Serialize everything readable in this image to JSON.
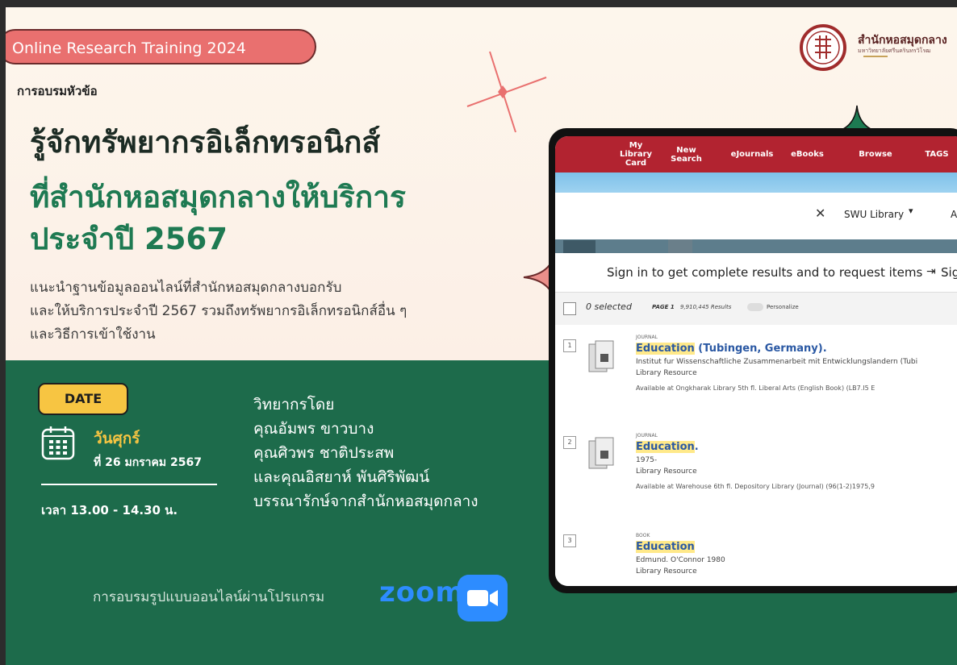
{
  "banner": "Online Research Training 2024",
  "subtitle_small": "การอบรมหัวข้อ",
  "title_line1": "รู้จักทรัพยากรอิเล็กทรอนิกส์",
  "title_line2": "ที่สำนักหอสมุดกลางให้บริการ",
  "title_line3": "ประจำปี 2567",
  "desc_line1": "แนะนำฐานข้อมูลออนไลน์ที่สำนักหอสมุดกลางบอกรับ",
  "desc_line2": "และให้บริการประจำปี 2567 รวมถึงทรัพยากรอิเล็กทรอนิกส์อื่น ๆ",
  "desc_line3": "และวิธีการเข้าใช้งาน",
  "date_badge": "DATE",
  "day": "วันศุกร์",
  "date": "ที่ 26 มกราคม 2567",
  "time": "เวลา 13.00 - 14.30 น.",
  "speakers": [
    "วิทยากรโดย",
    "คุณอัมพร ขาวบาง",
    "คุณศิวพร ชาติประสพ",
    "และคุณอิสยาห์ พันศิริพัฒน์",
    "บรรณารักษ์จากสำนักหอสมุดกลาง"
  ],
  "zoom_text": "การอบรมรูปแบบออนไลน์ผ่านโปรแกรม",
  "zoom_logo": "zoom",
  "library": {
    "name": "สำนักหอสมุดกลาง",
    "sub": "มหาวิทยาลัยศรีนครินทรวิโรฒ"
  },
  "screenshot": {
    "nav": [
      "My Library Card",
      "New Search",
      "eJournals",
      "eBooks",
      "Browse",
      "TAGS"
    ],
    "search_clear": "✕",
    "scope": "SWU Library",
    "scope_caret": "▾",
    "scope_next": "All",
    "signin": "Sign in to get complete results and to request items",
    "signin_link": "Sig",
    "selected": "0 selected",
    "page": "PAGE 1",
    "results_count": "9,910,445 Results",
    "personalize": "Personalize",
    "results": [
      {
        "num": "1",
        "type": "JOURNAL",
        "title_hl": "Education",
        "title_rest": " (Tubingen, Germany).",
        "line1": "Institut fur Wissenschaftliche Zusammenarbeit mit Entwicklungslandern (Tubi",
        "line2": "Library Resource",
        "avail": "Available at Ongkharak Library  5th fl. Liberal Arts (English Book) (LB7.I5 E"
      },
      {
        "num": "2",
        "type": "JOURNAL",
        "title_hl": "Education",
        "title_rest": ".",
        "line1": "1975-",
        "line2": "Library Resource",
        "avail": "Available at Warehouse  6th fl. Depository Library (Journal) (96(1-2)1975,9"
      },
      {
        "num": "3",
        "type": "BOOK",
        "title_hl": "Education",
        "title_rest": "",
        "line1": "Edmund. O'Connor 1980",
        "line2": "Library Resource",
        "avail": ""
      }
    ]
  },
  "colors": {
    "green": "#1d6b4b",
    "title_green": "#1e7a52",
    "pink": "#e9706f",
    "yellow": "#f7c542",
    "red_nav": "#b22330"
  }
}
